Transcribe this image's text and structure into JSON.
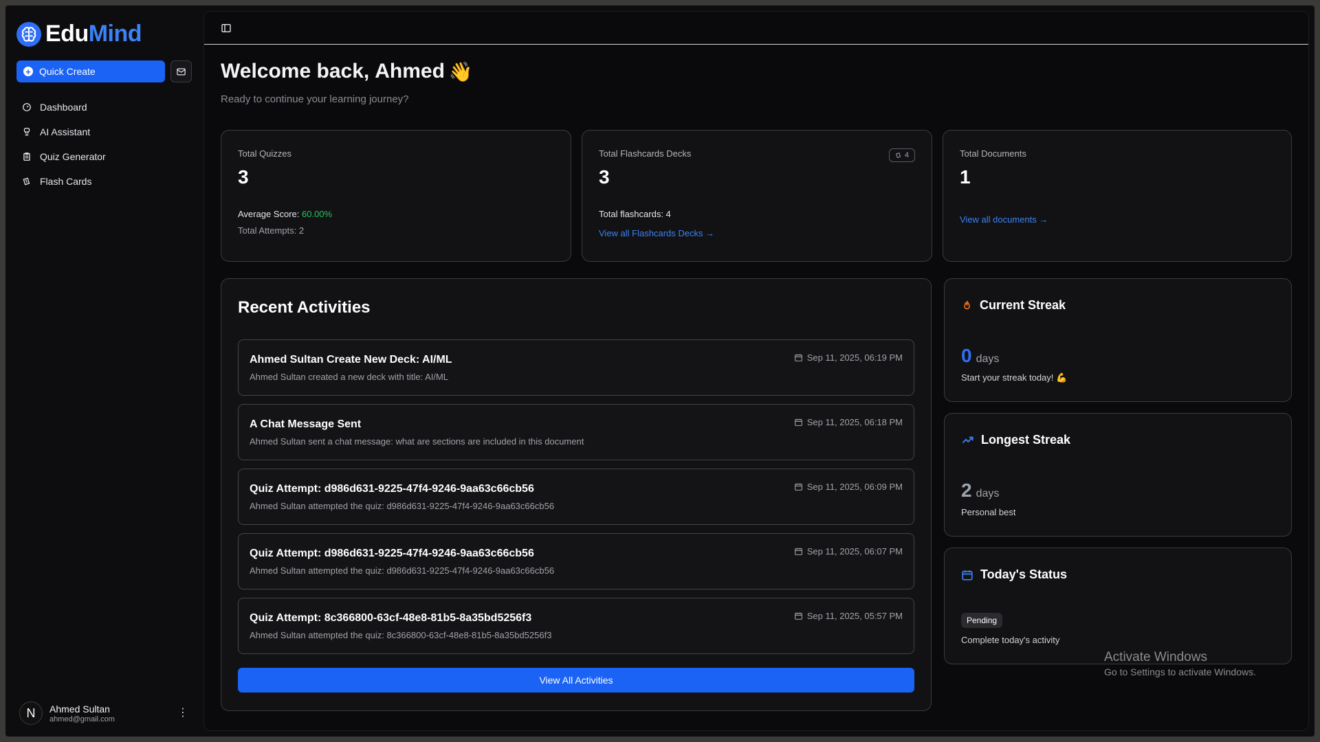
{
  "brand": {
    "name_a": "Edu",
    "name_b": "Mind"
  },
  "sidebar": {
    "quick_create": "Quick Create",
    "items": [
      {
        "label": "Dashboard",
        "icon": "dashboard-icon"
      },
      {
        "label": "AI Assistant",
        "icon": "bot-icon"
      },
      {
        "label": "Quiz Generator",
        "icon": "clipboard-icon"
      },
      {
        "label": "Flash Cards",
        "icon": "cards-icon"
      }
    ],
    "user": {
      "initial": "N",
      "name": "Ahmed Sultan",
      "email": "ahmed@gmail.com"
    }
  },
  "header": {
    "greeting": "Welcome back,",
    "name": "Ahmed",
    "wave": "👋",
    "subtitle": "Ready to continue your learning journey?"
  },
  "stats": {
    "quizzes": {
      "label": "Total Quizzes",
      "value": "3",
      "avg_label": "Average Score:",
      "avg_value": "60.00%",
      "attempts": "Total Attempts: 2"
    },
    "flashcards": {
      "label": "Total Flashcards Decks",
      "value": "3",
      "badge": "4",
      "total": "Total flashcards: 4",
      "link": "View all Flashcards Decks →"
    },
    "documents": {
      "label": "Total Documents",
      "value": "1",
      "link": "View all documents →"
    }
  },
  "recent": {
    "title": "Recent Activities",
    "items": [
      {
        "title": "Ahmed Sultan Create New Deck: AI/ML",
        "desc": "Ahmed Sultan created a new deck with title: AI/ML",
        "time": "Sep 11, 2025, 06:19 PM"
      },
      {
        "title": "A Chat Message Sent",
        "desc": "Ahmed Sultan sent a chat message: what are sections are included in this document",
        "time": "Sep 11, 2025, 06:18 PM"
      },
      {
        "title": "Quiz Attempt: d986d631-9225-47f4-9246-9aa63c66cb56",
        "desc": "Ahmed Sultan attempted the quiz: d986d631-9225-47f4-9246-9aa63c66cb56",
        "time": "Sep 11, 2025, 06:09 PM"
      },
      {
        "title": "Quiz Attempt: d986d631-9225-47f4-9246-9aa63c66cb56",
        "desc": "Ahmed Sultan attempted the quiz: d986d631-9225-47f4-9246-9aa63c66cb56",
        "time": "Sep 11, 2025, 06:07 PM"
      },
      {
        "title": "Quiz Attempt: 8c366800-63cf-48e8-81b5-8a35bd5256f3",
        "desc": "Ahmed Sultan attempted the quiz: 8c366800-63cf-48e8-81b5-8a35bd5256f3",
        "time": "Sep 11, 2025, 05:57 PM"
      }
    ],
    "view_all": "View All Activities"
  },
  "streak": {
    "title": "Current Streak",
    "value": "0",
    "unit": "days",
    "sub": "Start your streak today! 💪",
    "color": "#2f6ff5"
  },
  "longest": {
    "title": "Longest Streak",
    "value": "2",
    "unit": "days",
    "sub": "Personal best",
    "color": "#9ca3af"
  },
  "today": {
    "title": "Today's Status",
    "badge": "Pending",
    "sub": "Complete today's activity"
  },
  "watermark": {
    "line1": "Activate Windows",
    "line2": "Go to Settings to activate Windows."
  }
}
